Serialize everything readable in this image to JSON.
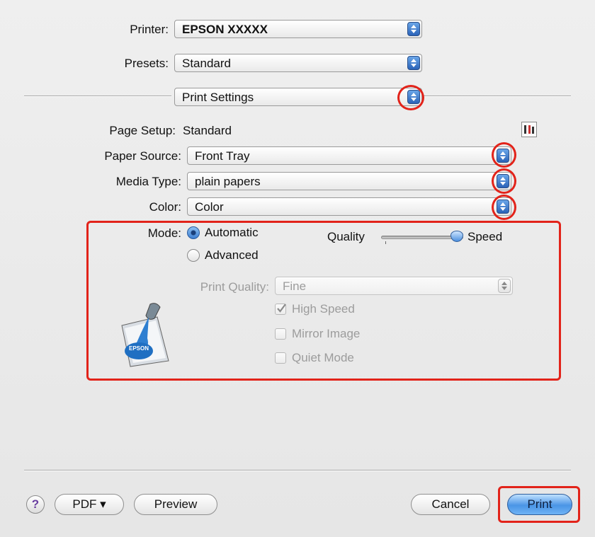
{
  "printer": {
    "label": "Printer:",
    "value": "EPSON XXXXX"
  },
  "presets": {
    "label": "Presets:",
    "value": "Standard"
  },
  "pane": {
    "value": "Print Settings"
  },
  "page_setup": {
    "label": "Page Setup:",
    "value": "Standard"
  },
  "paper_source": {
    "label": "Paper Source:",
    "value": "Front Tray"
  },
  "media_type": {
    "label": "Media Type:",
    "value": "plain papers"
  },
  "color": {
    "label": "Color:",
    "value": "Color"
  },
  "mode": {
    "label": "Mode:",
    "automatic": "Automatic",
    "advanced": "Advanced",
    "selected": "Automatic",
    "slider_left": "Quality",
    "slider_right": "Speed",
    "slider_level": 1.0
  },
  "print_quality": {
    "label": "Print Quality:",
    "value": "Fine"
  },
  "options": {
    "high_speed": {
      "label": "High Speed",
      "checked": true
    },
    "mirror_image": {
      "label": "Mirror Image",
      "checked": false
    },
    "quiet_mode": {
      "label": "Quiet Mode",
      "checked": false
    }
  },
  "logo_text": "EPSON",
  "buttons": {
    "help": "?",
    "pdf": "PDF ▾",
    "preview": "Preview",
    "cancel": "Cancel",
    "print": "Print"
  },
  "colors": {
    "highlight": "#e2231a",
    "accent": "#3f7fd0"
  }
}
